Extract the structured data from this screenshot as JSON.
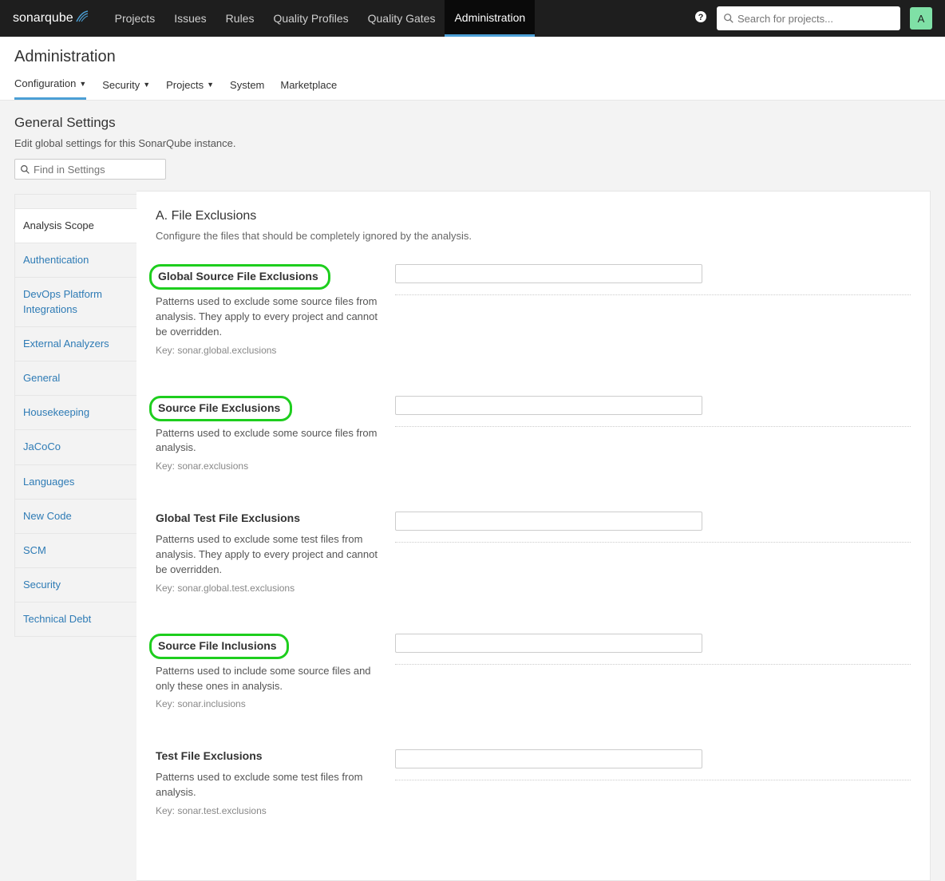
{
  "brand": "sonarqube",
  "nav": {
    "items": [
      "Projects",
      "Issues",
      "Rules",
      "Quality Profiles",
      "Quality Gates",
      "Administration"
    ],
    "active": "Administration",
    "search_placeholder": "Search for projects...",
    "avatar_letter": "A"
  },
  "page": {
    "title": "Administration",
    "tabs": [
      "Configuration",
      "Security",
      "Projects",
      "System",
      "Marketplace"
    ],
    "active_tab": "Configuration"
  },
  "settings_header": {
    "title": "General Settings",
    "description": "Edit global settings for this SonarQube instance.",
    "find_placeholder": "Find in Settings"
  },
  "sidebar": {
    "items": [
      "Analysis Scope",
      "Authentication",
      "DevOps Platform Integrations",
      "External Analyzers",
      "General",
      "Housekeeping",
      "JaCoCo",
      "Languages",
      "New Code",
      "SCM",
      "Security",
      "Technical Debt"
    ],
    "selected": "Analysis Scope"
  },
  "section": {
    "title": "A. File Exclusions",
    "description": "Configure the files that should be completely ignored by the analysis."
  },
  "settings": [
    {
      "label": "Global Source File Exclusions",
      "help": "Patterns used to exclude some source files from analysis. They apply to every project and cannot be overridden.",
      "key": "Key: sonar.global.exclusions",
      "highlighted": true
    },
    {
      "label": "Source File Exclusions",
      "help": "Patterns used to exclude some source files from analysis.",
      "key": "Key: sonar.exclusions",
      "highlighted": true
    },
    {
      "label": "Global Test File Exclusions",
      "help": "Patterns used to exclude some test files from analysis. They apply to every project and cannot be overridden.",
      "key": "Key: sonar.global.test.exclusions",
      "highlighted": false
    },
    {
      "label": "Source File Inclusions",
      "help": "Patterns used to include some source files and only these ones in analysis.",
      "key": "Key: sonar.inclusions",
      "highlighted": true
    },
    {
      "label": "Test File Exclusions",
      "help": "Patterns used to exclude some test files from analysis.",
      "key": "Key: sonar.test.exclusions",
      "highlighted": false
    }
  ]
}
